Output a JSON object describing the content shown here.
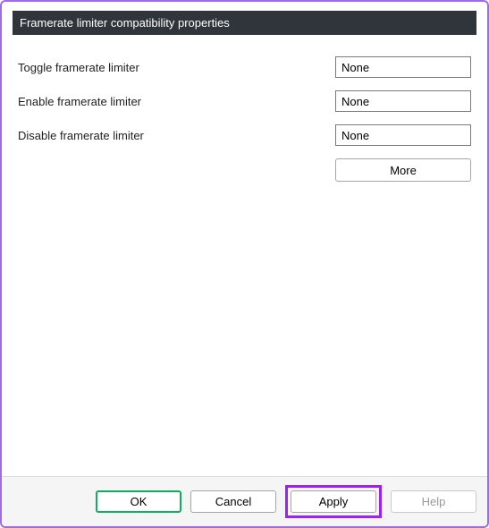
{
  "section": {
    "title": "Framerate limiter compatibility properties"
  },
  "props": {
    "rows": [
      {
        "label": "Toggle framerate limiter",
        "value": "None"
      },
      {
        "label": "Enable framerate limiter",
        "value": "None"
      },
      {
        "label": "Disable framerate limiter",
        "value": "None"
      }
    ],
    "more_label": "More"
  },
  "buttons": {
    "ok": "OK",
    "cancel": "Cancel",
    "apply": "Apply",
    "help": "Help"
  }
}
